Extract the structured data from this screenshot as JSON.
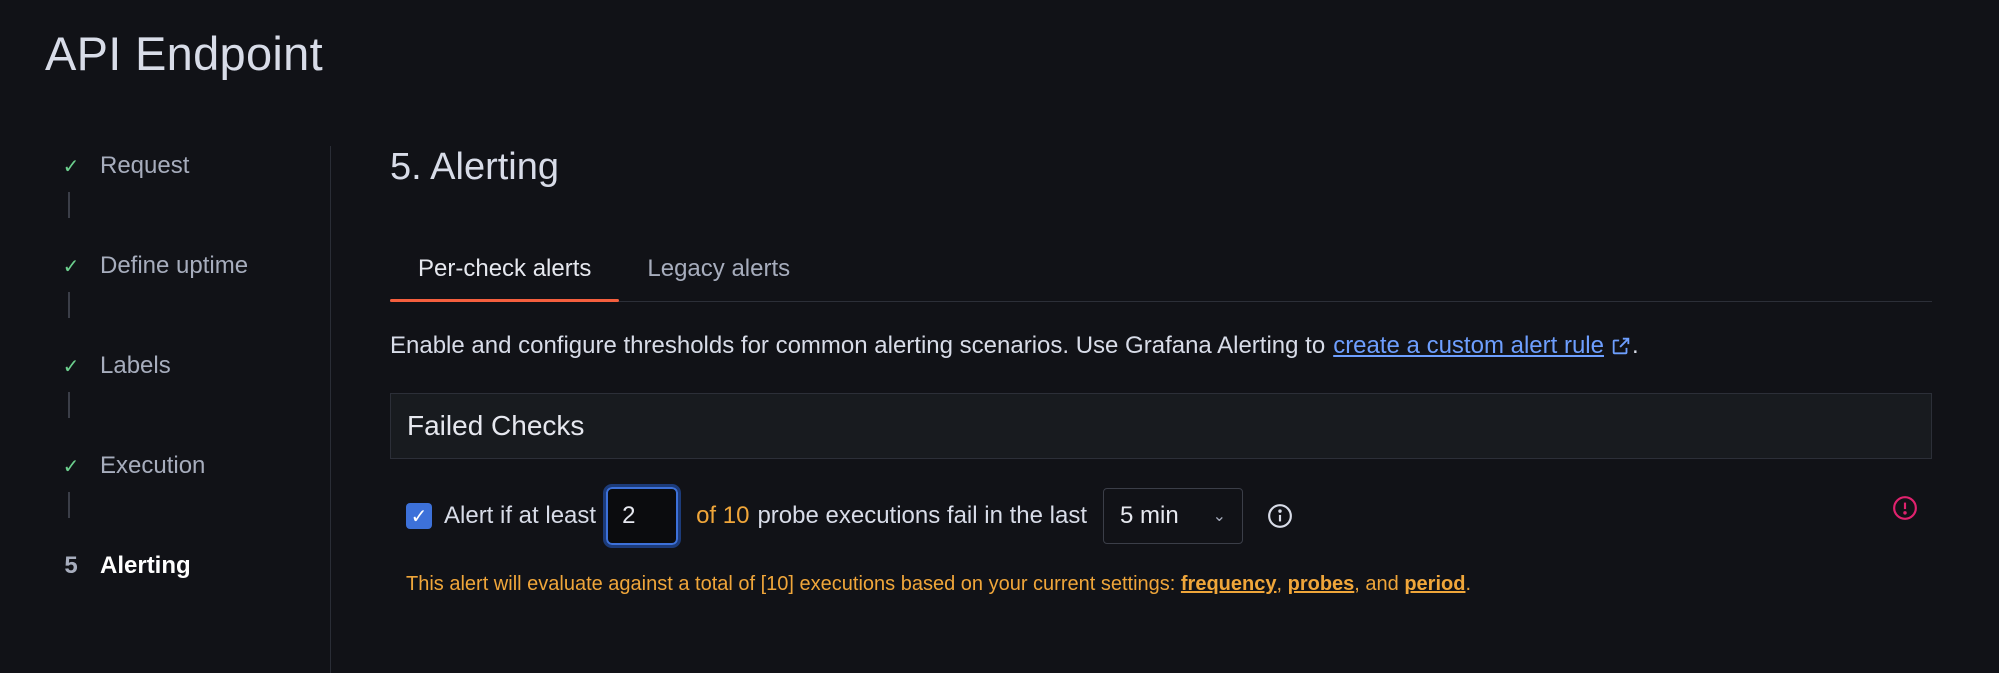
{
  "page": {
    "title": "API Endpoint"
  },
  "stepper": {
    "steps": [
      {
        "label": "Request",
        "state": "done",
        "icon": "check-icon"
      },
      {
        "label": "Define uptime",
        "state": "done",
        "icon": "check-icon"
      },
      {
        "label": "Labels",
        "state": "done",
        "icon": "check-icon"
      },
      {
        "label": "Execution",
        "state": "done",
        "icon": "check-icon"
      },
      {
        "label": "Alerting",
        "state": "active",
        "number": "5"
      }
    ]
  },
  "section": {
    "title": "5. Alerting"
  },
  "tabs": [
    {
      "label": "Per-check alerts",
      "active": true
    },
    {
      "label": "Legacy alerts",
      "active": false
    }
  ],
  "description": {
    "text": "Enable and configure thresholds for common alerting scenarios. Use Grafana Alerting to",
    "link_text": "create a custom alert rule",
    "link_icon": "external-link-icon",
    "suffix": "."
  },
  "failed_checks": {
    "title": "Failed Checks",
    "checkbox_checked": true,
    "prefix": "Alert if at least",
    "threshold_value": "2",
    "of_text": "of 10",
    "middle": "probe executions fail in the last",
    "period_value": "5 min",
    "info_icon": "info-icon",
    "warning_icon": "warning-circle-icon"
  },
  "helper": {
    "text": "This alert will evaluate against a total of [10] executions based on your current settings:",
    "links": [
      "frequency",
      "probes",
      "period"
    ],
    "sep1": ",",
    "sep2": ", and",
    "suffix": "."
  },
  "colors": {
    "accent_tab": "#f55f3e",
    "link": "#6e9fff",
    "warning": "#f0a63a",
    "success": "#6ccf8e",
    "primary": "#3d71d9",
    "error": "#e0226e"
  }
}
